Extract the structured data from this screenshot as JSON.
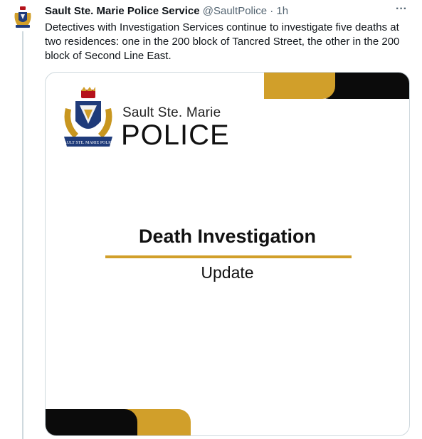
{
  "tweet": {
    "display_name": "Sault Ste. Marie Police Service",
    "handle": "@SaultPolice",
    "separator": "·",
    "time": "1h",
    "more_icon": "more-horizontal-icon",
    "more_label": "···",
    "text": "Detectives with Investigation Services continue to investigate five deaths at two residences: one in the 200 block of Tancred Street, the other in the 200 block of Second Line East."
  },
  "image": {
    "logo_line1": "Sault Ste. Marie",
    "logo_line2": "POLICE",
    "crest_banner": "SAULT STE. MARIE POLICE",
    "headline": "Death Investigation",
    "subhead": "Update"
  },
  "colors": {
    "gold": "#d19f2a",
    "black": "#0b0b0b",
    "text": "#0f1419",
    "muted": "#536471",
    "border": "#cfd9de"
  }
}
